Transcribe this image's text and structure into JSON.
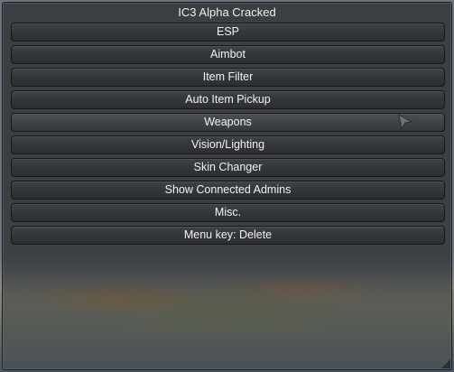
{
  "window": {
    "title": "IC3 Alpha Cracked"
  },
  "menu": {
    "items": [
      {
        "label": "ESP"
      },
      {
        "label": "Aimbot"
      },
      {
        "label": "Item Filter"
      },
      {
        "label": "Auto Item Pickup"
      },
      {
        "label": "Weapons"
      },
      {
        "label": "Vision/Lighting"
      },
      {
        "label": "Skin Changer"
      },
      {
        "label": "Show Connected Admins"
      },
      {
        "label": "Misc."
      },
      {
        "label": "Menu key: Delete"
      }
    ],
    "hovered_item": "Weapons"
  },
  "icons": {
    "cursor": "mouse-pointer-icon"
  }
}
